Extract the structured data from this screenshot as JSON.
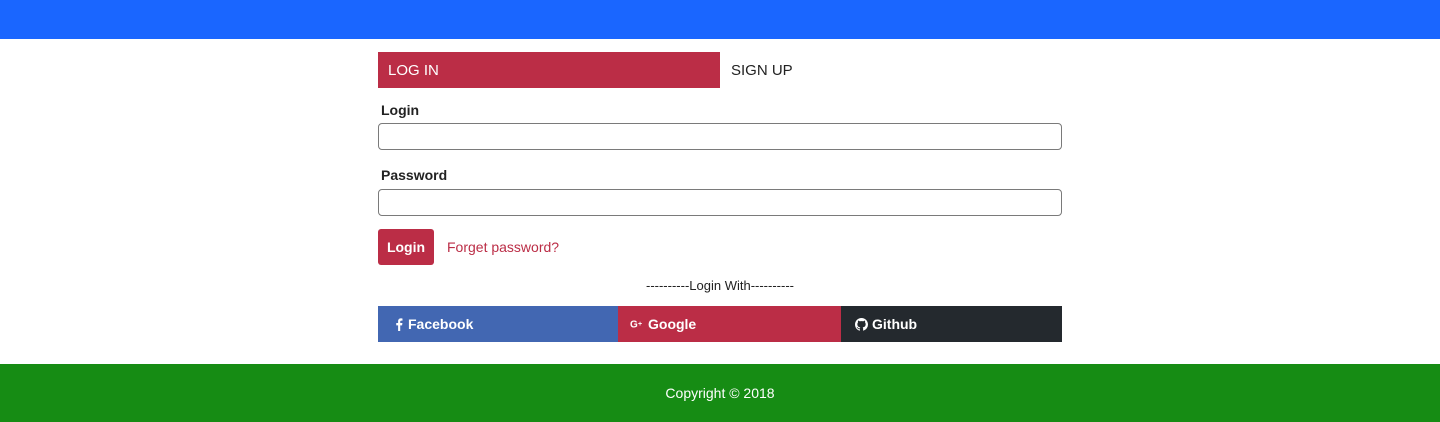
{
  "colors": {
    "header_bg": "#1a66ff",
    "accent": "#bb2d46",
    "facebook": "#4267b2",
    "github": "#24292e",
    "footer_bg": "#168c14"
  },
  "tabs": {
    "login_label": "LOG IN",
    "signup_label": "SIGN UP",
    "active": "LOG IN"
  },
  "form": {
    "login_label": "Login",
    "login_value": "",
    "password_label": "Password",
    "password_value": "",
    "submit_label": "Login",
    "forgot_label": "Forget password?"
  },
  "social": {
    "divider_text": "----------Login With----------",
    "buttons": [
      {
        "label": "Facebook",
        "icon": "facebook-icon"
      },
      {
        "label": "Google",
        "icon": "google-plus-icon"
      },
      {
        "label": "Github",
        "icon": "github-icon"
      }
    ]
  },
  "footer": {
    "copyright": "Copyright © 2018"
  }
}
